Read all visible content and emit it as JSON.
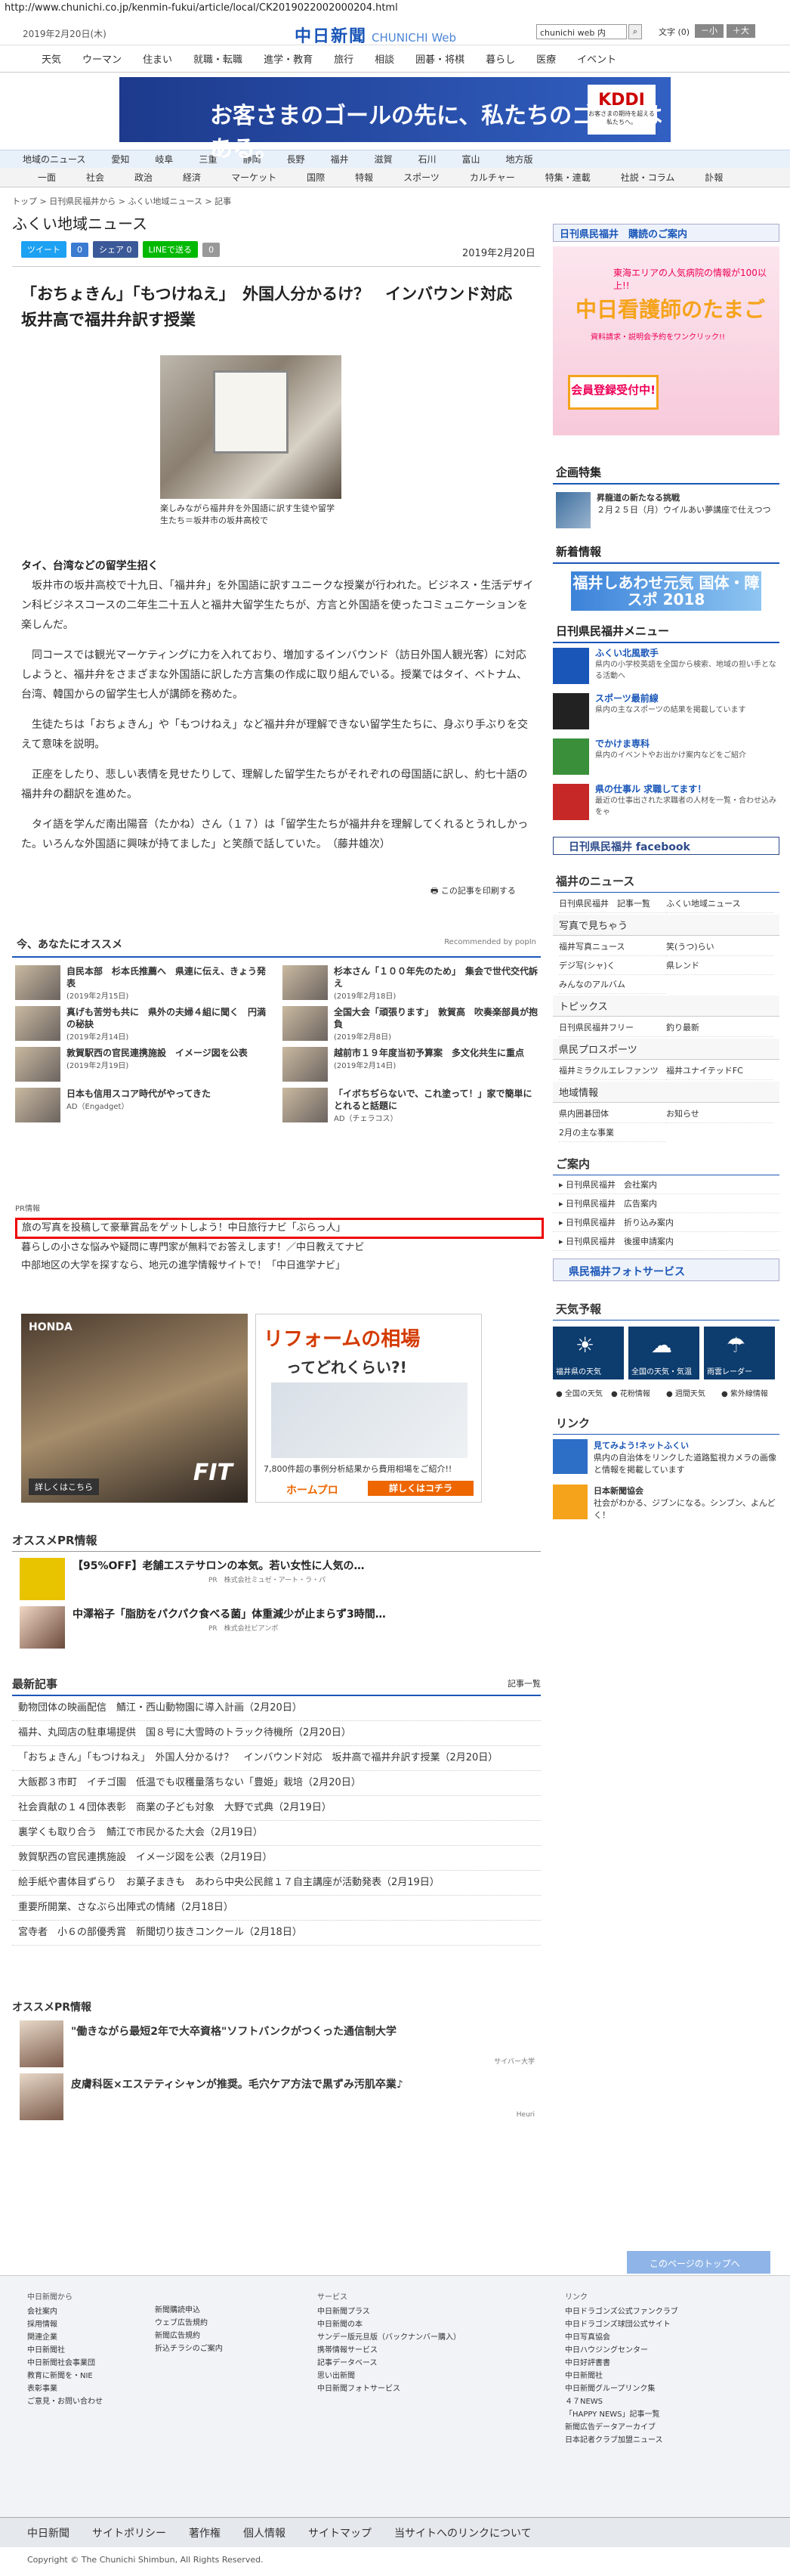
{
  "url": "http://www.chunichi.co.jp/kenmin-fukui/article/local/CK2019022002000204.html",
  "header": {
    "date": "2019年2月20日(木)",
    "logo": "中日新聞",
    "logo_sub": "CHUNICHI Web",
    "search_placeholder": "chunichi web 内",
    "font_label": "文字",
    "font_small": "小",
    "font_large": "大"
  },
  "gnav": [
    "天気",
    "ウーマン",
    "住まい",
    "就職・転職",
    "進学・教育",
    "旅行",
    "相談",
    "囲碁・将棋",
    "暮らし",
    "医療",
    "イベント"
  ],
  "banner": {
    "text": "お客さまのゴールの先に、私たちのゴールはある。",
    "brand": "KDDI",
    "sub": "お客さまの期待を超える私たちへ。"
  },
  "region_nav": [
    "地域のニュース",
    "愛知",
    "岐阜",
    "三重",
    "静岡",
    "長野",
    "福井",
    "滋賀",
    "石川",
    "富山",
    "地方版"
  ],
  "cat_nav": [
    "一面",
    "社会",
    "政治",
    "経済",
    "マーケット",
    "国際",
    "特報",
    "スポーツ",
    "カルチャー",
    "特集・連載",
    "社説・コラム",
    "訃報"
  ],
  "breadcrumb": "トップ > 日刊県民福井から > ふくい地域ニュース > 記事",
  "section_title": "ふくい地域ニュース",
  "share": [
    "ツイート",
    "0",
    "シェア 0",
    "LINEで送る",
    "0"
  ],
  "article": {
    "date": "2019年2月20日",
    "title": "「おちょきん」「もつけねえ」　外国人分かるけ？　インバウンド対応　坂井高で福井弁訳す授業",
    "caption": "楽しみながら福井弁を外国語に訳す生徒や留学生たち＝坂井市の坂井高校で",
    "subhead": "タイ、台湾などの留学生招く",
    "paras": [
      "坂井市の坂井高校で十九日、「福井弁」を外国語に訳すユニークな授業が行われた。ビジネス・生活デザイン科ビジネスコースの二年生二十五人と福井大留学生たちが、方言と外国語を使ったコミュニケーションを楽しんだ。",
      "同コースでは観光マーケティングに力を入れており、増加するインバウンド（訪日外国人観光客）に対応しようと、福井弁をさまざまな外国語に訳した方言集の作成に取り組んでいる。授業ではタイ、ベトナム、台湾、韓国からの留学生七人が講師を務めた。",
      "生徒たちは「おちょきん」や「もつけねえ」など福井弁が理解できない留学生たちに、身ぶり手ぶりを交えて意味を説明。",
      "正座をしたり、悲しい表情を見せたりして、理解した留学生たちがそれぞれの母国語に訳し、約七十語の福井弁の翻訳を進めた。",
      "タイ語を学んだ南出陽音（たかね）さん（１７）は「留学生たちが福井弁を理解してくれるとうれしかった。いろんな外国語に興味が持てました」と笑顔で話していた。　（藤井雄次）"
    ],
    "print": "この記事を印刷する"
  },
  "osusume": {
    "title": "今、あなたにオススメ",
    "recby": "Recommended by popIn",
    "items": [
      {
        "t": "自民本部　杉本氏推薦へ　県連に伝え、きょう発表",
        "d": "(2019年2月15日)"
      },
      {
        "t": "杉本さん「１００年先のため」　集会で世代交代訴え",
        "d": "(2019年2月18日)"
      },
      {
        "t": "真げも苦労も共に　県外の夫婦４組に聞く　円満の秘訣",
        "d": "(2019年2月14日)"
      },
      {
        "t": "全国大会「頑張ります」　敦賀高　吹奏楽部員が抱負",
        "d": "(2019年2月8日)"
      },
      {
        "t": "敦賀駅西の官民連携施設　イメージ図を公表",
        "d": "(2019年2月19日)"
      },
      {
        "t": "越前市１９年度当初予算案　多文化共生に重点",
        "d": "(2019年2月14日)"
      },
      {
        "t": "日本も信用スコア時代がやってきた",
        "d": "AD（Engadget）"
      },
      {
        "t": "「イボちぢらないで、これ塗って！」家で簡単にとれると話題に",
        "d": "AD（チェラコス）"
      }
    ]
  },
  "pr": {
    "label": "PR情報",
    "rows": [
      "旅の写真を投稿して豪華賞品をゲットしよう！中日旅行ナビ「ぶらっ人」",
      "暮らしの小さな悩みや疑問に専門家が無料でお答えします！／中日教えてナビ",
      "中部地区の大学を探すなら、地元の進学情報サイトで！「中日進学ナビ」"
    ]
  },
  "ads": {
    "honda": "HONDA",
    "fit": "FIT",
    "honda_btn": "詳しくはこちら",
    "reform_title": "リフォームの相場",
    "reform_sub": "ってどれくらい?!",
    "reform_note": "7,800件超の事例分析結果から費用相場をご紹介!!",
    "reform_brand": "ホームプロ",
    "reform_btn": "詳しくはコチラ"
  },
  "prinfo": {
    "title": "オススメPR情報",
    "items": [
      {
        "t": "【95%OFF】老舗エステサロンの本気。若い女性に人気の…",
        "s": "PR　株式会社ミュゼ・アート・ラ・パ"
      },
      {
        "t": "中澤裕子「脂肪をパクパク食べる菌」体重減少が止まらず3時間…",
        "s": "PR　株式会社ビアンポ"
      }
    ]
  },
  "latest": {
    "title": "最新記事",
    "more": "記事一覧",
    "rows": [
      "動物団体の映画配信　鯖江・西山動物園に導入計画（2月20日）",
      "福井、丸岡店の駐車場提供　国８号に大雪時のトラック待機所（2月20日）",
      "「おちょきん」「もつけねえ」　外国人分かるけ？　インバウンド対応　坂井高で福井弁訳す授業（2月20日）",
      "大飯郡３市町　イチゴ園　低温でも収穫量落ちない「豊姫」栽培（2月20日）",
      "社会貢献の１４団体表彰　商業の子ども対象　大野で式典（2月19日）",
      "裏学くも取り合う　鯖江で市民かるた大会（2月19日）",
      "敦賀駅西の官民連携施設　イメージ図を公表（2月19日）",
      "絵手紙や書体目ずらり　お菓子まきも　あわら中央公民館１７自主講座が活動発表（2月19日）",
      "重要所開業、さなぶら出陣式の情緒（2月18日）",
      "宮寺者　小６の部優秀賞　新聞切り抜きコンクール（2月18日）"
    ]
  },
  "pr2": {
    "title": "オススメPR情報",
    "items": [
      {
        "t": "\"働きながら最短2年で大卒資格\"ソフトバンクがつくった通信制大学",
        "s": "サイバー大学"
      },
      {
        "t": "皮膚科医×エステティシャンが推奨。毛穴ケア方法で黒ずみ汚肌卒業♪",
        "s": "Heuri"
      }
    ]
  },
  "side": {
    "koudoku": "日刊県民福井　購読のご案内",
    "nurse": {
      "a": "東海エリアの人気病院の情報が100以上!!",
      "b": "中日看護師のたまご",
      "c": "資料請求・説明会予約をワンクリック!!",
      "d": "会員登録受付中!"
    },
    "kikaku": "企画特集",
    "kikaku_item": {
      "t": "昇龍道の新たなる挑戦",
      "d": "２月２５日（月）ウイルあい夢講座で仕えつつ"
    },
    "newinfo_title": "新着情報",
    "newinfo": "福井しあわせ元気 国体・障スポ 2018",
    "menu_title": "日刊県民福井メニュー",
    "menu": [
      {
        "b": "ふくい北風歌手",
        "s": "県内の小学校英語を全国から検索、地域の担い手となる活動へ"
      },
      {
        "b": "スポーツ最前線",
        "s": "県内の主なスポーツの結果を掲載しています"
      },
      {
        "b": "でかけま専科",
        "s": "県内のイベントやお出かけ案内などをご紹介"
      },
      {
        "b": "県の仕事ル 求職してます！",
        "s": "最近の仕事出された求職者の人材を一覧・合わせ込みをゃ"
      }
    ],
    "fb": "日刊県民福井 facebook",
    "fn_title": "福井のニュース",
    "fn": [
      "日刊県民福井　記事一覧",
      "ふくい地域ニュース"
    ],
    "photo_title": "写真で見ちゃう",
    "photo_list": [
      "福井写真ニュース",
      "笑(うつ)らい",
      "デジ写(シャ)く",
      "県レンド",
      "みんなのアルバム"
    ],
    "topics_title": "トピックス",
    "topics": [
      "日刊県民福井フリー",
      "釣り最新"
    ],
    "sports_title": "県民プロスポーツ",
    "sports": [
      "福井ミラクルエレファンツ",
      "福井ユナイテッドFC"
    ],
    "chiiki_title": "地域情報",
    "chiiki": [
      "県内囲碁団体",
      "お知らせ",
      "2月の主な事業"
    ],
    "annai_title": "ご案内",
    "annai": [
      "日刊県民福井　会社案内",
      "日刊県民福井　広告案内",
      "日刊県民福井　折り込み案内",
      "日刊県民福井　後援申請案内"
    ],
    "photosvc": "県民福井フォトサービス",
    "wx_title": "天気予報",
    "wx": [
      "福井県の天気",
      "全国の天気・気温",
      "雨雲レーダー"
    ],
    "wxl": [
      "全国の天気",
      "花粉情報",
      "週間天気",
      "紫外線情報"
    ],
    "link_title": "リンク",
    "link": [
      {
        "b": "見てみよう!ネットふくい",
        "s": "県内の自治体をリンクした道路監視カメラの画像と情報を掲載しています"
      },
      {
        "b": "日本新聞協会",
        "s": "社会がわかる、ジブンになる。シンブン、よんどく！"
      }
    ]
  },
  "footer": {
    "totop": "このページのトップへ",
    "c1": [
      "中日新聞から",
      "会社案内",
      "採用情報",
      "関連企業",
      "中日新聞社",
      "中日新聞社会事業団",
      "教育に新聞を・NIE",
      "表彰事業",
      "ご意見・お問い合わせ"
    ],
    "c2": [
      "新聞購読申込",
      "ウェブ広告規約",
      "新聞広告規約",
      "折込チラシのご案内"
    ],
    "c3": [
      "サービス",
      "中日新聞プラス",
      "中日新聞の本",
      "サンデー版元旦版（バックナンバー購入）",
      "携帯情報サービス",
      "記事データベース",
      "思い出新聞",
      "中日新聞フォトサービス"
    ],
    "c4": [
      "リンク",
      "中日ドラゴンズ公式ファンクラブ",
      "中日ドラゴンズ球団公式サイト",
      "中日写真協会",
      "中日ハウジングセンター",
      "中日好評書書",
      "中日新聞社",
      "中日新聞グループリンク集",
      "４７NEWS",
      "「HAPPY NEWS」記事一覧",
      "新聞広告データアーカイブ",
      "日本記者クラブ加盟ニュース"
    ],
    "bar": [
      "中日新聞",
      "サイトポリシー",
      "著作権",
      "個人情報",
      "サイトマップ",
      "当サイトへのリンクについて"
    ],
    "copy": "Copyright © The Chunichi Shimbun, All Rights Reserved."
  }
}
